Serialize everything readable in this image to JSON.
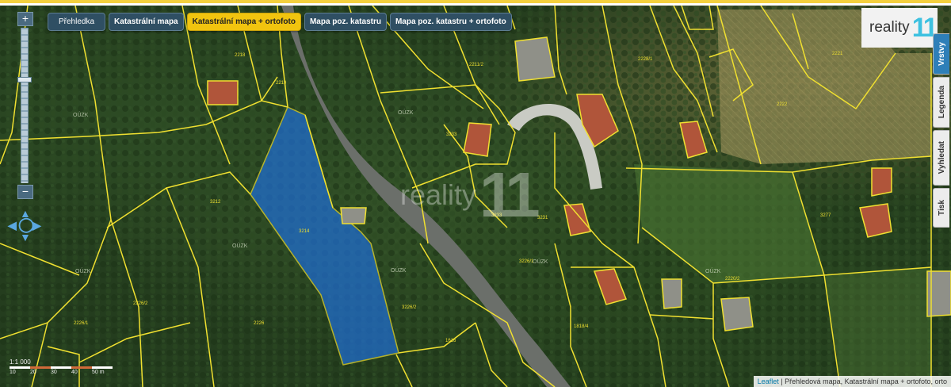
{
  "nav_buttons": [
    {
      "label": "Přehledka",
      "active": false
    },
    {
      "label": "Katastrální mapa",
      "active": false
    },
    {
      "label": "Katastrální mapa + ortofoto",
      "active": true
    },
    {
      "label": "Mapa poz. katastru",
      "active": false
    },
    {
      "label": "Mapa poz. katastru + ortofoto",
      "active": false
    }
  ],
  "zoom": {
    "in": "+",
    "out": "−"
  },
  "logo": {
    "text": "reality",
    "number": "11"
  },
  "side_tabs": [
    {
      "label": "Vrstvy",
      "active": true
    },
    {
      "label": "Legenda",
      "active": false
    },
    {
      "label": "Vyhledat",
      "active": false
    },
    {
      "label": "Tisk",
      "active": false
    }
  ],
  "watermark": {
    "text": "reality",
    "number": "11"
  },
  "scale": {
    "label": "1:1 000",
    "ticks": [
      "10",
      "20",
      "30",
      "40",
      "50 m"
    ]
  },
  "attribution": {
    "link": "Leaflet",
    "text": " | Přehledová mapa, Katastrální mapa + ortofoto, orto"
  },
  "parcel_labels": [
    "3212",
    "3214",
    "2218",
    "2219",
    "3226/1",
    "3226/2",
    "2226/2",
    "2226/1",
    "3233",
    "3231",
    "2228/1",
    "1818/4",
    "2226",
    "1616",
    "2220/2",
    "3277",
    "2222",
    "2211/2",
    "2221",
    "3233"
  ],
  "road_labels": [
    "OÚZK",
    "OÚZK",
    "OÚZK",
    "OÚZK",
    "OÚZK",
    "OÚZK",
    "OÚZK"
  ],
  "colors": {
    "parcel_line": "#f0e030",
    "highlight_fill": "#1f6fd8",
    "active_button": "#f1c40f",
    "button": "#2f4f63"
  }
}
